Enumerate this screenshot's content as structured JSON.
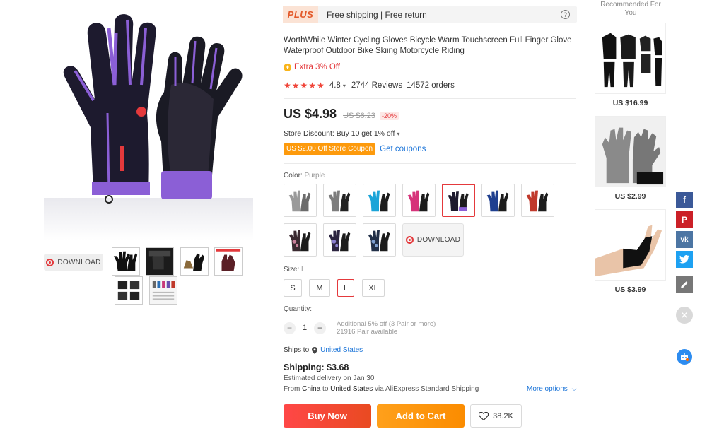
{
  "gallery": {
    "download_label": "DOWNLOAD",
    "thumbnail_count": 6
  },
  "plus_bar": {
    "logo": "PLUS",
    "text": "Free shipping | Free return",
    "help_icon": "question-circle-icon"
  },
  "product": {
    "title": "WorthWhile Winter Cycling Gloves Bicycle Warm Touchscreen Full Finger Glove Waterproof Outdoor Bike Skiing Motorcycle Riding",
    "extra_off": "Extra 3% Off",
    "rating": "4.8",
    "stars": 5,
    "reviews": "2744 Reviews",
    "orders": "14572 orders"
  },
  "price": {
    "current": "US $4.98",
    "original": "US $6.23",
    "discount": "-20%"
  },
  "store": {
    "discount_text": "Store Discount: Buy 10 get 1% off",
    "coupon": "US $2.00 Off Store Coupon",
    "get_coupons": "Get coupons"
  },
  "color": {
    "label": "Color:",
    "selected": "Purple",
    "options": [
      "Gray",
      "Dark Gray",
      "Blue",
      "Pink",
      "Purple",
      "Navy",
      "Red",
      "Camo Pink",
      "Camo Purple",
      "Camo Blue"
    ],
    "download_label": "DOWNLOAD"
  },
  "size": {
    "label": "Size:",
    "selected": "L",
    "options": [
      "S",
      "M",
      "L",
      "XL"
    ]
  },
  "quantity": {
    "label": "Quantity:",
    "minus": "−",
    "value": "1",
    "plus": "+",
    "note": "Additional 5% off (3 Pair or more)",
    "available": "21916 Pair available"
  },
  "shipping": {
    "ships_to_label": "Ships to",
    "ships_to_country": "United States",
    "title": "Shipping: $3.68",
    "estimated": "Estimated delivery on Jan 30",
    "route_from": "From",
    "route_origin": "China",
    "route_to": "to",
    "route_dest": "United States",
    "route_via": "via AliExpress Standard Shipping",
    "more_options": "More options"
  },
  "actions": {
    "buy_now": "Buy Now",
    "add_to_cart": "Add to Cart",
    "wishlist_count": "38.2K"
  },
  "recommended": {
    "title": "Recommended For You",
    "items": [
      {
        "price": "US $16.99"
      },
      {
        "price": "US $2.99"
      },
      {
        "price": "US $3.99"
      }
    ]
  },
  "share": {
    "icons": [
      "facebook-icon",
      "pinterest-icon",
      "vk-icon",
      "twitter-icon",
      "edit-icon"
    ],
    "colors": [
      "#3b5998",
      "#cb2027",
      "#4c75a3",
      "#1da1f2",
      "#777777"
    ]
  }
}
